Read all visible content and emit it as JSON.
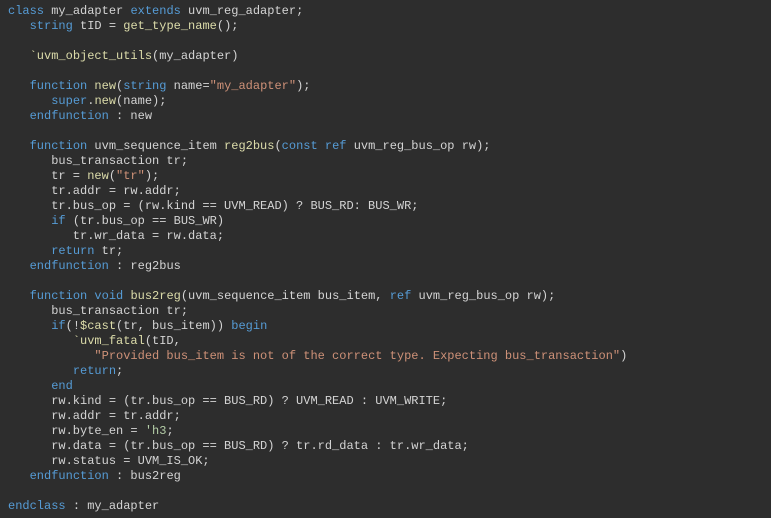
{
  "code": {
    "lines": [
      [
        {
          "t": "class ",
          "c": "kw"
        },
        {
          "t": "my_adapter ",
          "c": "txt"
        },
        {
          "t": "extends ",
          "c": "kw"
        },
        {
          "t": "uvm_reg_adapter;",
          "c": "txt"
        }
      ],
      [
        {
          "t": "   ",
          "c": "txt"
        },
        {
          "t": "string ",
          "c": "kw"
        },
        {
          "t": "tID = ",
          "c": "txt"
        },
        {
          "t": "get_type_name",
          "c": "fn"
        },
        {
          "t": "();",
          "c": "txt"
        }
      ],
      [
        {
          "t": "",
          "c": "txt"
        }
      ],
      [
        {
          "t": "   ",
          "c": "txt"
        },
        {
          "t": "`uvm_object_utils",
          "c": "fn"
        },
        {
          "t": "(my_adapter)",
          "c": "txt"
        }
      ],
      [
        {
          "t": "",
          "c": "txt"
        }
      ],
      [
        {
          "t": "   ",
          "c": "txt"
        },
        {
          "t": "function ",
          "c": "kw"
        },
        {
          "t": "new",
          "c": "fn"
        },
        {
          "t": "(",
          "c": "txt"
        },
        {
          "t": "string ",
          "c": "kw"
        },
        {
          "t": "name=",
          "c": "txt"
        },
        {
          "t": "\"my_adapter\"",
          "c": "str"
        },
        {
          "t": ");",
          "c": "txt"
        }
      ],
      [
        {
          "t": "      ",
          "c": "txt"
        },
        {
          "t": "super",
          "c": "kw"
        },
        {
          "t": ".",
          "c": "txt"
        },
        {
          "t": "new",
          "c": "fn"
        },
        {
          "t": "(name);",
          "c": "txt"
        }
      ],
      [
        {
          "t": "   ",
          "c": "txt"
        },
        {
          "t": "endfunction ",
          "c": "kw"
        },
        {
          "t": ": new",
          "c": "txt"
        }
      ],
      [
        {
          "t": "",
          "c": "txt"
        }
      ],
      [
        {
          "t": "   ",
          "c": "txt"
        },
        {
          "t": "function ",
          "c": "kw"
        },
        {
          "t": "uvm_sequence_item ",
          "c": "txt"
        },
        {
          "t": "reg2bus",
          "c": "fn"
        },
        {
          "t": "(",
          "c": "txt"
        },
        {
          "t": "const ref ",
          "c": "kw"
        },
        {
          "t": "uvm_reg_bus_op rw);",
          "c": "txt"
        }
      ],
      [
        {
          "t": "      bus_transaction tr;",
          "c": "txt"
        }
      ],
      [
        {
          "t": "      tr = ",
          "c": "txt"
        },
        {
          "t": "new",
          "c": "fn"
        },
        {
          "t": "(",
          "c": "txt"
        },
        {
          "t": "\"tr\"",
          "c": "str"
        },
        {
          "t": ");",
          "c": "txt"
        }
      ],
      [
        {
          "t": "      tr.addr = rw.addr;",
          "c": "txt"
        }
      ],
      [
        {
          "t": "      tr.bus_op = (rw.kind == UVM_READ) ? BUS_RD: BUS_WR;",
          "c": "txt"
        }
      ],
      [
        {
          "t": "      ",
          "c": "txt"
        },
        {
          "t": "if ",
          "c": "kw"
        },
        {
          "t": "(tr.bus_op == BUS_WR)",
          "c": "txt"
        }
      ],
      [
        {
          "t": "         tr.wr_data = rw.data;",
          "c": "txt"
        }
      ],
      [
        {
          "t": "      ",
          "c": "txt"
        },
        {
          "t": "return ",
          "c": "kw"
        },
        {
          "t": "tr;",
          "c": "txt"
        }
      ],
      [
        {
          "t": "   ",
          "c": "txt"
        },
        {
          "t": "endfunction ",
          "c": "kw"
        },
        {
          "t": ": reg2bus",
          "c": "txt"
        }
      ],
      [
        {
          "t": "",
          "c": "txt"
        }
      ],
      [
        {
          "t": "   ",
          "c": "txt"
        },
        {
          "t": "function void ",
          "c": "kw"
        },
        {
          "t": "bus2reg",
          "c": "fn"
        },
        {
          "t": "(uvm_sequence_item bus_item, ",
          "c": "txt"
        },
        {
          "t": "ref ",
          "c": "kw"
        },
        {
          "t": "uvm_reg_bus_op rw);",
          "c": "txt"
        }
      ],
      [
        {
          "t": "      bus_transaction tr;",
          "c": "txt"
        }
      ],
      [
        {
          "t": "      ",
          "c": "txt"
        },
        {
          "t": "if",
          "c": "kw"
        },
        {
          "t": "(!",
          "c": "txt"
        },
        {
          "t": "$cast",
          "c": "fn"
        },
        {
          "t": "(tr, bus_item)) ",
          "c": "txt"
        },
        {
          "t": "begin",
          "c": "kw"
        }
      ],
      [
        {
          "t": "         ",
          "c": "txt"
        },
        {
          "t": "`uvm_fatal",
          "c": "fn"
        },
        {
          "t": "(tID,",
          "c": "txt"
        }
      ],
      [
        {
          "t": "            ",
          "c": "txt"
        },
        {
          "t": "\"Provided bus_item is not of the correct type. Expecting bus_transaction\"",
          "c": "str"
        },
        {
          "t": ")",
          "c": "txt"
        }
      ],
      [
        {
          "t": "         ",
          "c": "txt"
        },
        {
          "t": "return",
          "c": "kw"
        },
        {
          "t": ";",
          "c": "txt"
        }
      ],
      [
        {
          "t": "      ",
          "c": "txt"
        },
        {
          "t": "end",
          "c": "kw"
        }
      ],
      [
        {
          "t": "      rw.kind = (tr.bus_op == BUS_RD) ? UVM_READ : UVM_WRITE;",
          "c": "txt"
        }
      ],
      [
        {
          "t": "      rw.addr = tr.addr;",
          "c": "txt"
        }
      ],
      [
        {
          "t": "      rw.byte_en = ",
          "c": "txt"
        },
        {
          "t": "'h3",
          "c": "num"
        },
        {
          "t": ";",
          "c": "txt"
        }
      ],
      [
        {
          "t": "      rw.data = (tr.bus_op == BUS_RD) ? tr.rd_data : tr.wr_data;",
          "c": "txt"
        }
      ],
      [
        {
          "t": "      rw.status = UVM_IS_OK;",
          "c": "txt"
        }
      ],
      [
        {
          "t": "   ",
          "c": "txt"
        },
        {
          "t": "endfunction ",
          "c": "kw"
        },
        {
          "t": ": bus2reg",
          "c": "txt"
        }
      ],
      [
        {
          "t": "",
          "c": "txt"
        }
      ],
      [
        {
          "t": "endclass ",
          "c": "kw"
        },
        {
          "t": ": my_adapter",
          "c": "txt"
        }
      ]
    ]
  }
}
